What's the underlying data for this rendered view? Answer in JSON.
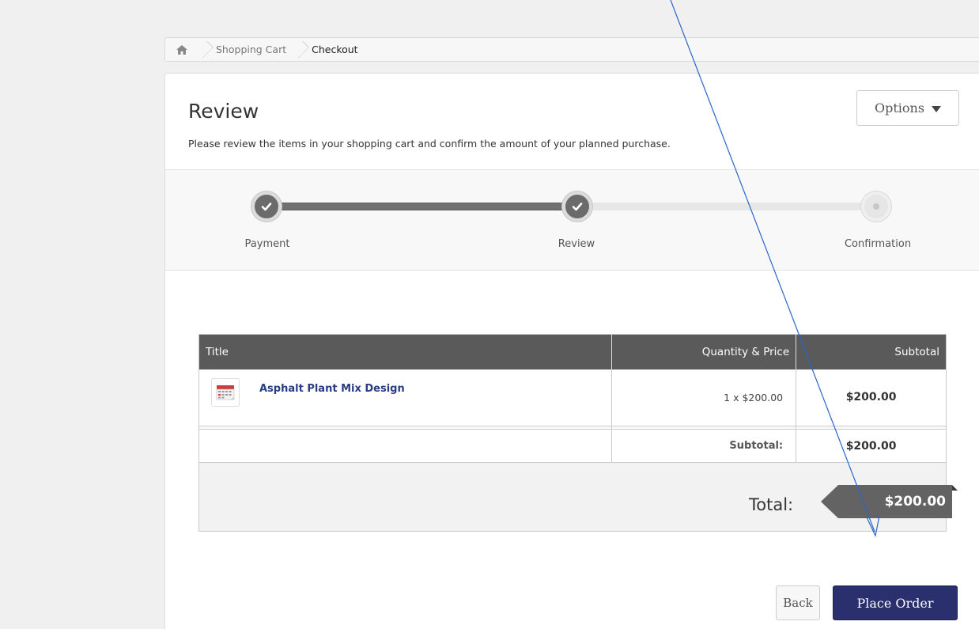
{
  "breadcrumb": {
    "home_icon": "home-icon",
    "items": [
      "Shopping Cart",
      "Checkout"
    ]
  },
  "header": {
    "title": "Review",
    "subtitle": "Please review the items in your shopping cart and confirm the amount of your planned purchase.",
    "options_label": "Options"
  },
  "stepper": {
    "steps": [
      {
        "label": "Payment",
        "state": "done"
      },
      {
        "label": "Review",
        "state": "done"
      },
      {
        "label": "Confirmation",
        "state": "pending"
      }
    ]
  },
  "table": {
    "headers": [
      "Title",
      "Quantity & Price",
      "Subtotal"
    ],
    "items": [
      {
        "title": "Asphalt Plant Mix Design",
        "icon": "calendar-icon",
        "qty_price": "1 x $200.00",
        "subtotal": "$200.00"
      }
    ],
    "subtotal_label": "Subtotal:",
    "subtotal_value": "$200.00",
    "total_label": "Total:",
    "total_value": "$200.00"
  },
  "actions": {
    "back_label": "Back",
    "place_order_label": "Place Order"
  },
  "colors": {
    "header_bg": "#5a5a5a",
    "link": "#2a3c82",
    "primary_button": "#2a2f6e",
    "annotation_arrow": "#2a66c9"
  }
}
